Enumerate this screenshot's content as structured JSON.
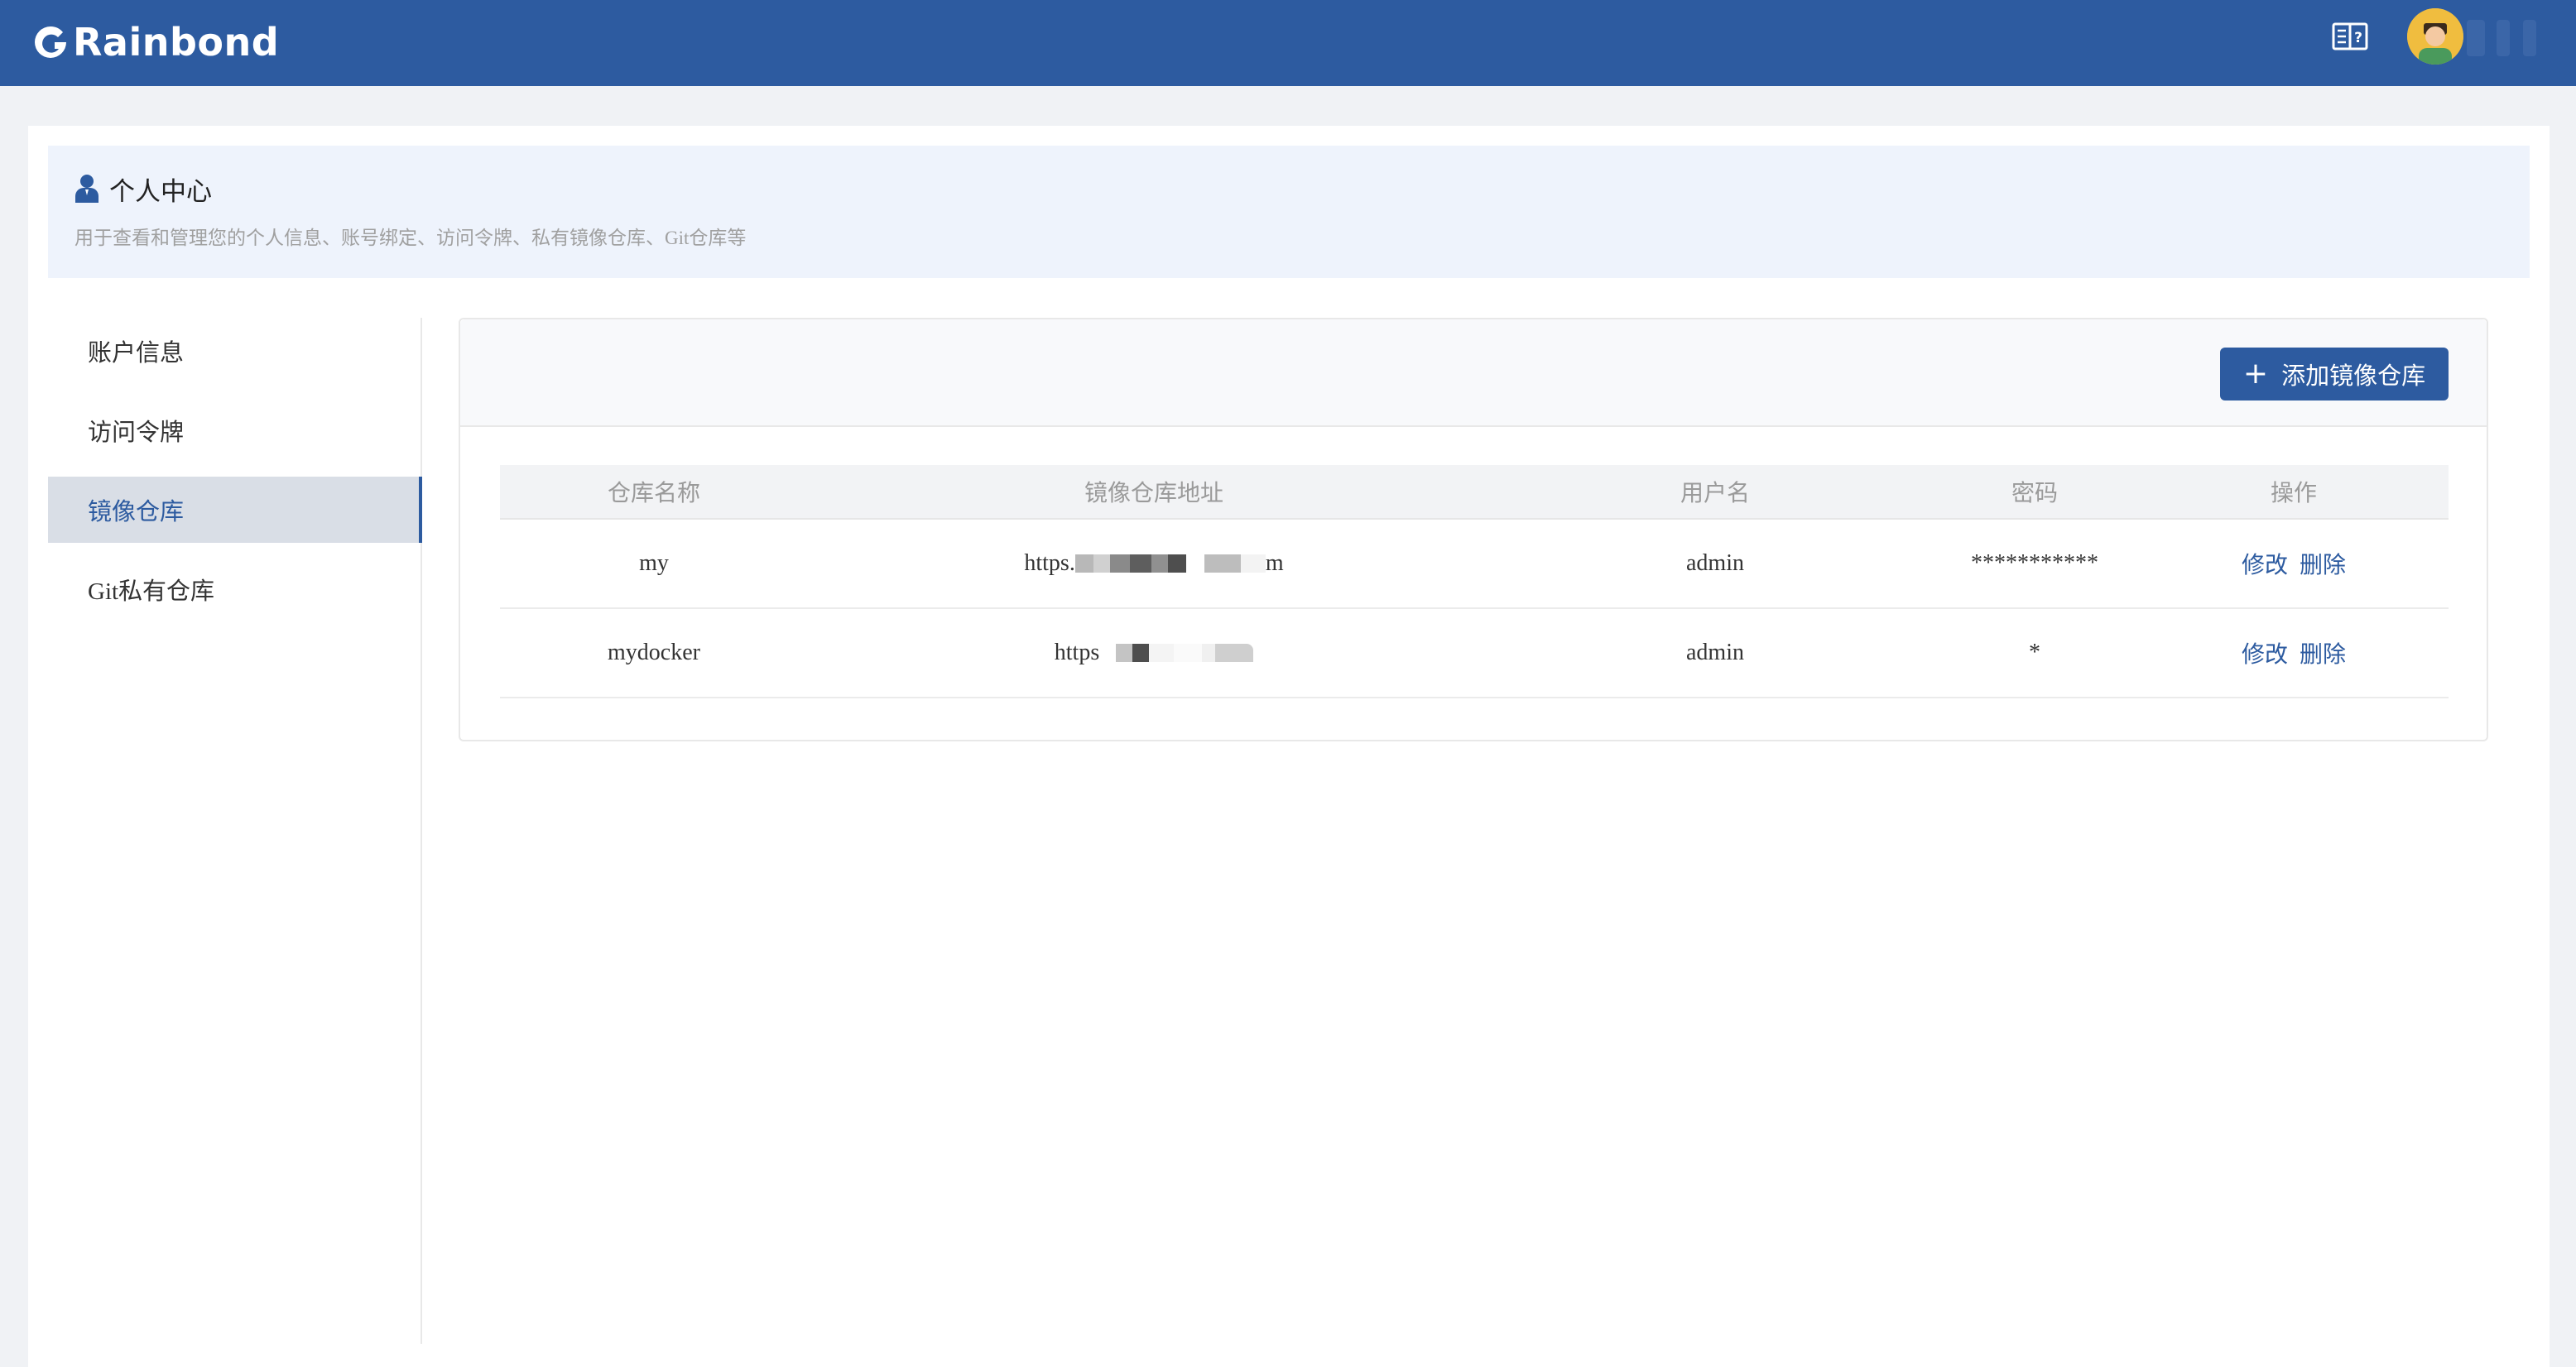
{
  "brand": {
    "name": "Rainbond",
    "primary_color": "#2d5ba0"
  },
  "header": {
    "icons": [
      "docs-book-icon",
      "user-avatar"
    ]
  },
  "banner": {
    "title": "个人中心",
    "subtitle": "用于查看和管理您的个人信息、账号绑定、访问令牌、私有镜像仓库、Git仓库等",
    "icon": "user-icon"
  },
  "sidebar": {
    "items": [
      {
        "label": "账户信息",
        "active": false
      },
      {
        "label": "访问令牌",
        "active": false
      },
      {
        "label": "镜像仓库",
        "active": true
      },
      {
        "label": "Git私有仓库",
        "active": false
      }
    ]
  },
  "toolbar": {
    "add_label": "添加镜像仓库"
  },
  "table": {
    "columns": [
      "仓库名称",
      "镜像仓库地址",
      "用户名",
      "密码",
      "操作"
    ],
    "rows": [
      {
        "name": "my",
        "url_prefix": "https.",
        "url_suffix": "m",
        "username": "admin",
        "password": "***********",
        "edit": "修改",
        "delete": "删除"
      },
      {
        "name": "mydocker",
        "url_prefix": "https",
        "url_suffix": "",
        "username": "admin",
        "password": "*",
        "edit": "修改",
        "delete": "删除"
      }
    ]
  }
}
